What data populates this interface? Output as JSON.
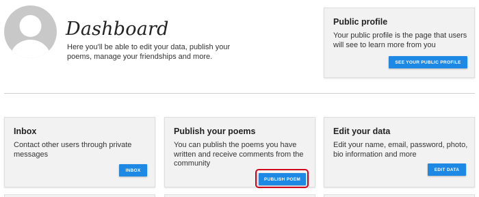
{
  "header": {
    "title": "Dashboard",
    "intro": "Here you'll be able to edit your data, publish your poems, manage your friendships and more."
  },
  "public_profile": {
    "title": "Public profile",
    "text": "Your public profile is the page that users will see to learn more from you",
    "button": "SEE YOUR PUBLIC PROFILE"
  },
  "cards": [
    {
      "title": "Inbox",
      "text": "Contact other users through private messages",
      "button": "INBOX"
    },
    {
      "title": "Publish your poems",
      "text": "You can publish the poems you have written and receive comments from the community",
      "button": "PUBLISH POEM"
    },
    {
      "title": "Edit your data",
      "text": "Edit your name, email, password, photo, bio information and more",
      "button": "EDIT DATA"
    }
  ],
  "colors": {
    "button": "#1e88e5",
    "highlight": "#d0021b",
    "card_bg": "#f2f2f2"
  }
}
